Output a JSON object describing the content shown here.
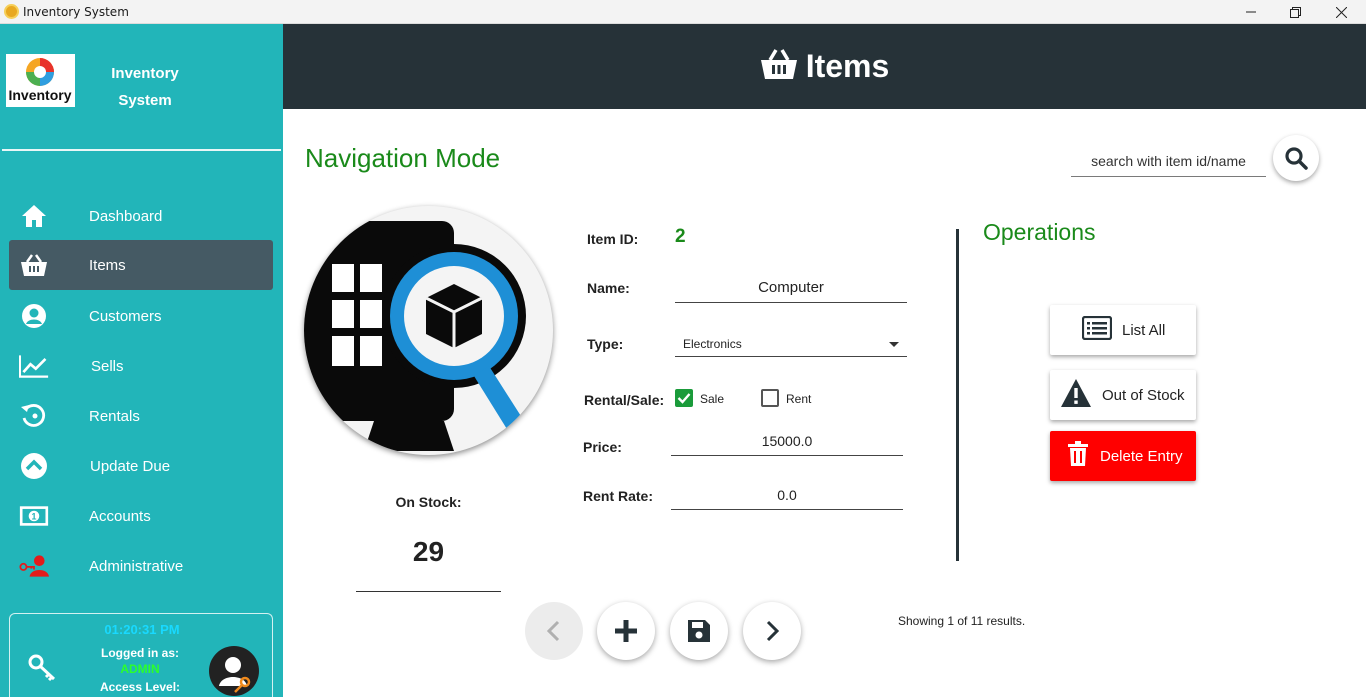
{
  "window": {
    "title": "Inventory System",
    "controls": [
      "minimize",
      "restore",
      "close"
    ]
  },
  "sidebar": {
    "app_name_line1": "Inventory",
    "app_name_line2": "System",
    "logo_text": "Inventory",
    "nav": [
      {
        "label": "Dashboard",
        "icon": "home-icon",
        "active": false
      },
      {
        "label": "Items",
        "icon": "basket-icon",
        "active": true
      },
      {
        "label": "Customers",
        "icon": "user-circle-icon",
        "active": false
      },
      {
        "label": "Sells",
        "icon": "chart-line-icon",
        "active": false
      },
      {
        "label": "Rentals",
        "icon": "history-icon",
        "active": false
      },
      {
        "label": "Update Due",
        "icon": "chevron-up-circle-icon",
        "active": false
      },
      {
        "label": "Accounts",
        "icon": "money-bill-icon",
        "active": false
      },
      {
        "label": "Administrative",
        "icon": "user-key-icon",
        "active": false
      }
    ],
    "login": {
      "clock": "01:20:31 PM",
      "logged_label": "Logged in as:",
      "user": "ADMIN",
      "access_label": "Access Level:"
    }
  },
  "header": {
    "title": "Items",
    "icon": "basket-icon"
  },
  "main": {
    "mode_title": "Navigation Mode",
    "search": {
      "placeholder": "search with item id/name",
      "value": ""
    },
    "stock": {
      "label": "On Stock:",
      "value": "29"
    },
    "form": {
      "item_id_label": "Item ID:",
      "item_id_value": "2",
      "name_label": "Name:",
      "name_value": "Computer",
      "type_label": "Type:",
      "type_value": "Electronics",
      "rental_sale_label": "Rental/Sale:",
      "sale_label": "Sale",
      "sale_checked": true,
      "rent_label": "Rent",
      "rent_checked": false,
      "price_label": "Price:",
      "price_value": "15000.0",
      "rent_rate_label": "Rent Rate:",
      "rent_rate_value": "0.0"
    },
    "operations": {
      "title": "Operations",
      "list_all": "List All",
      "out_of_stock": "Out of Stock",
      "delete_entry": "Delete Entry"
    },
    "results_text": "Showing 1 of 11 results."
  },
  "colors": {
    "sidebar": "#22b5b9",
    "sidebar_active": "#455a64",
    "header": "#263238",
    "accent_green": "#1a8a1a",
    "danger": "#ff0000",
    "clock": "#19d9ff",
    "user_green": "#2bff2b"
  }
}
